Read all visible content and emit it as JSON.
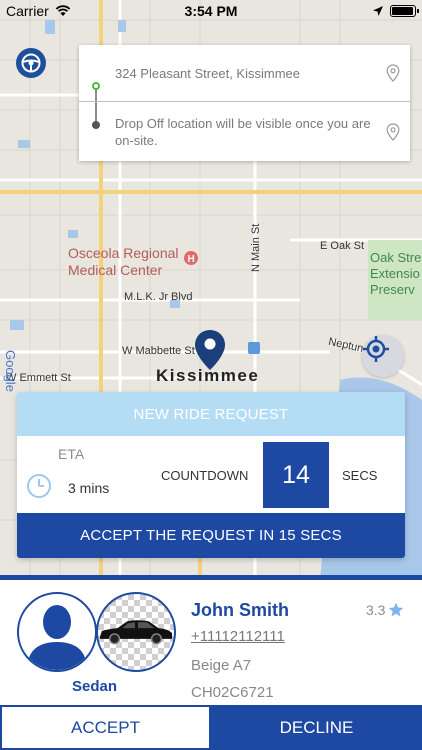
{
  "status_bar": {
    "carrier": "Carrier",
    "time": "3:54 PM",
    "icons": [
      "wifi-icon",
      "location-arrow-icon",
      "battery-icon"
    ],
    "battery_level": 0.95
  },
  "map": {
    "labels": {
      "hospital": "Osceola Regional\nMedical Center",
      "mlk": "M.L.K. Jr Blvd",
      "mabbette": "W Mabbette St",
      "emmett": "W Emmett St",
      "n_main": "N Main St",
      "oak": "E Oak St",
      "neptune": "Neptune",
      "city": "Kissimmee",
      "park": "Oak Stre\nExtensio\nPreserv",
      "google": "Google"
    }
  },
  "address_card": {
    "pickup": "324 Pleasant Street, Kissimmee",
    "dropoff": "Drop Off location will be visible once you are on-site."
  },
  "request": {
    "header": "NEW RIDE REQUEST",
    "eta_label": "ETA",
    "eta_value": "3 mins",
    "countdown_label": "COUNTDOWN",
    "countdown_value": "14",
    "secs_label": "SECS",
    "accept_banner": "ACCEPT THE REQUEST IN  15 SECS"
  },
  "driver": {
    "name": "John Smith",
    "phone": "+11112112111",
    "rating": "3.3",
    "car_type": "Sedan",
    "car_color": "Beige A7",
    "plate": "CH02C6721"
  },
  "actions": {
    "accept": "ACCEPT",
    "decline": "DECLINE"
  },
  "colors": {
    "primary": "#1d49a3",
    "header_light": "#b5dcf5",
    "star": "#7fb2ee"
  }
}
